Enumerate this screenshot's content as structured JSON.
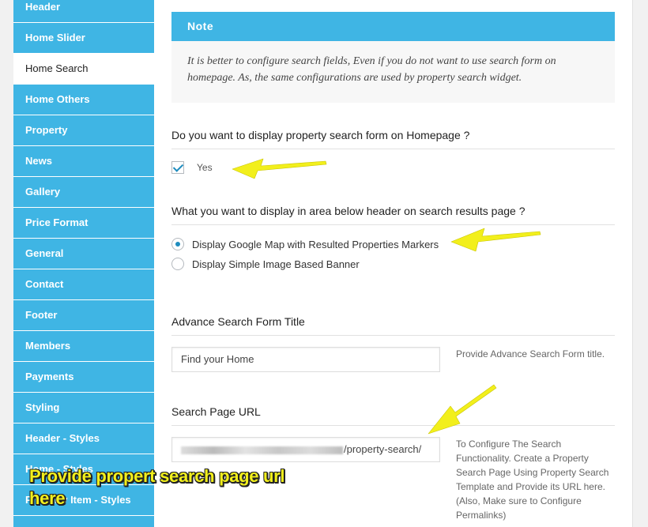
{
  "sidebar": {
    "items": [
      {
        "label": "Header"
      },
      {
        "label": "Home Slider"
      },
      {
        "label": "Home Search"
      },
      {
        "label": "Home Others"
      },
      {
        "label": "Property"
      },
      {
        "label": "News"
      },
      {
        "label": "Gallery"
      },
      {
        "label": "Price Format"
      },
      {
        "label": "General"
      },
      {
        "label": "Contact"
      },
      {
        "label": "Footer"
      },
      {
        "label": "Members"
      },
      {
        "label": "Payments"
      },
      {
        "label": "Styling"
      },
      {
        "label": "Header - Styles"
      },
      {
        "label": "Home - Styles"
      },
      {
        "label": "Property Item - Styles"
      }
    ],
    "active": "Home Search"
  },
  "note": {
    "title": "Note",
    "text": "It is better to configure search fields, Even if you do not want to use search form on homepage. As, the same configurations are used by property search widget."
  },
  "search_form_section": {
    "title": "Do you want to display property search form on Homepage ?",
    "checkbox_label": "Yes",
    "checked": true
  },
  "below_header_section": {
    "title": "What you want to display in area below header on search results page ?",
    "options": [
      {
        "label": "Display Google Map with Resulted Properties Markers",
        "selected": true
      },
      {
        "label": "Display Simple Image Based Banner",
        "selected": false
      }
    ]
  },
  "form_title_section": {
    "title": "Advance Search Form Title",
    "value": "Find your Home",
    "description": "Provide Advance Search Form title."
  },
  "search_url_section": {
    "title": "Search Page URL",
    "value_suffix": "/property-search/",
    "description": "To Configure The Search Functionality. Create a Property Search Page Using Property Search Template and Provide its URL here. (Also, Make sure to Configure Permalinks)"
  },
  "annotation": {
    "text": "Provide propert search page url here"
  },
  "colors": {
    "accent": "#3fb5e4",
    "arrow": "#f2ef1c",
    "check": "#1e8cbe"
  }
}
